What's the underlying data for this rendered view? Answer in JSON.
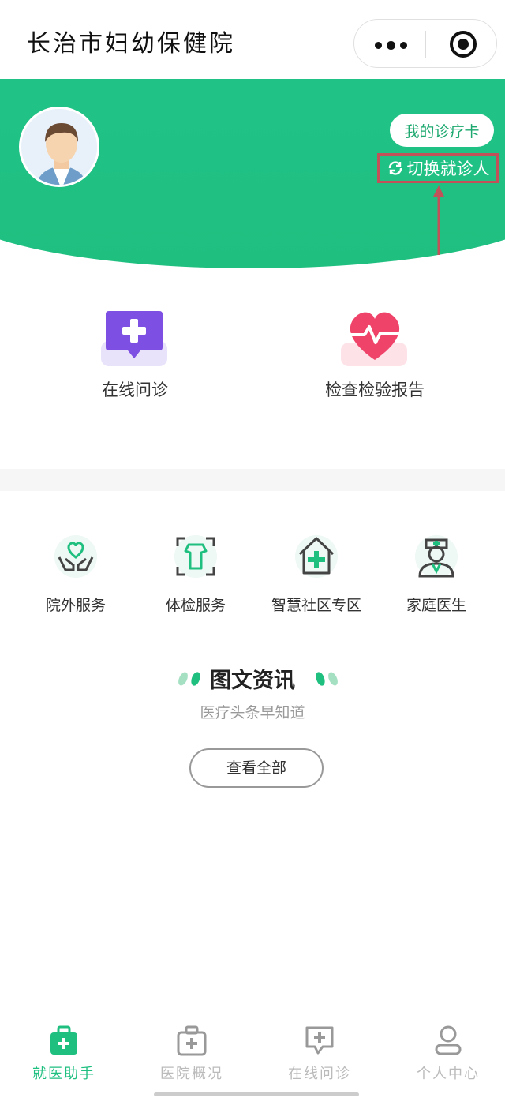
{
  "header": {
    "title": "长治市妇幼保健院"
  },
  "hero": {
    "card_label": "我的诊疗卡",
    "switch_label": "切换就诊人"
  },
  "main_tiles": [
    {
      "label": "在线问诊",
      "icon": "chat-plus-icon"
    },
    {
      "label": "检查检验报告",
      "icon": "heart-pulse-icon"
    }
  ],
  "services": [
    {
      "label": "院外服务",
      "icon": "heart-hands-icon"
    },
    {
      "label": "体检服务",
      "icon": "body-scan-icon"
    },
    {
      "label": "智慧社区专区",
      "icon": "community-house-icon"
    },
    {
      "label": "家庭医生",
      "icon": "doctor-icon"
    }
  ],
  "news": {
    "title": "图文资讯",
    "subtitle": "医疗头条早知道",
    "view_all": "查看全部"
  },
  "tabbar": [
    {
      "label": "就医助手",
      "icon": "medical-kit-icon",
      "active": true
    },
    {
      "label": "医院概况",
      "icon": "hospital-kit-icon",
      "active": false
    },
    {
      "label": "在线问诊",
      "icon": "consult-icon",
      "active": false
    },
    {
      "label": "个人中心",
      "icon": "user-icon",
      "active": false
    }
  ],
  "colors": {
    "brand": "#1fbf80",
    "highlight": "#c2525a"
  }
}
